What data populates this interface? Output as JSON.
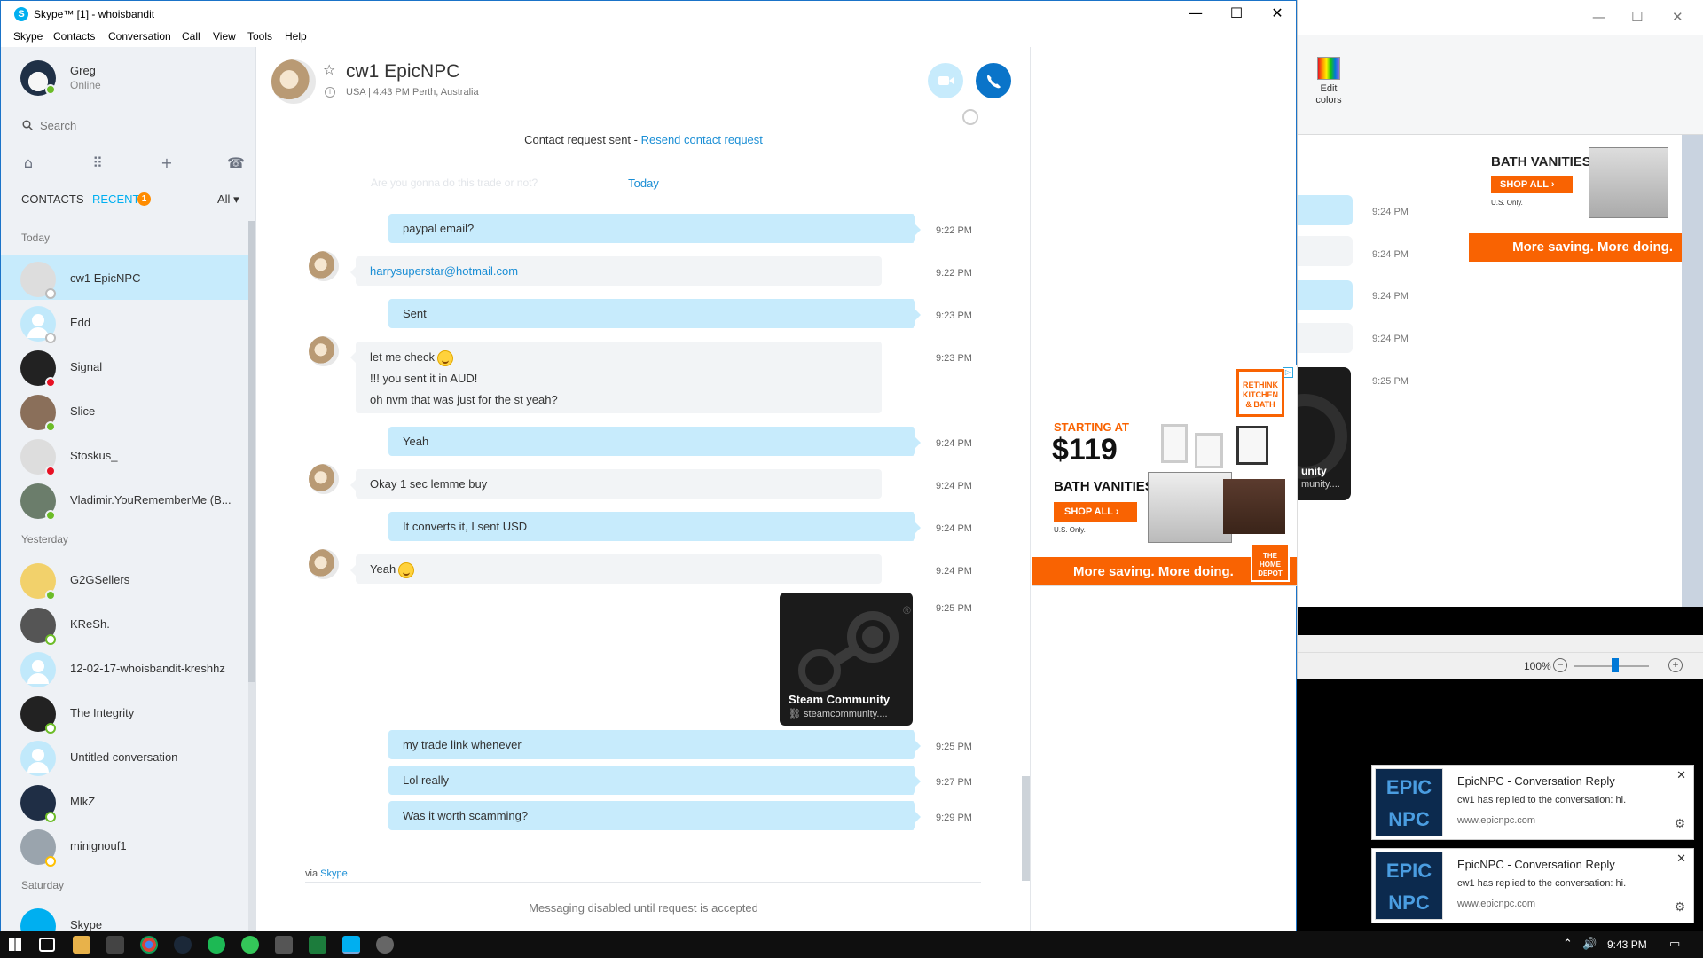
{
  "window": {
    "title": "Skype™ [1] - whoisbandit",
    "minimize": "—",
    "maximize": "☐",
    "close": "✕"
  },
  "menu": [
    "Skype",
    "Contacts",
    "Conversation",
    "Call",
    "View",
    "Tools",
    "Help"
  ],
  "profile": {
    "name": "Greg",
    "status": "Online"
  },
  "search": {
    "placeholder": "Search"
  },
  "tabs": {
    "contacts": "CONTACTS",
    "recent": "RECENT",
    "recent_badge": "1",
    "filter": "All"
  },
  "sections": {
    "today": "Today",
    "yesterday": "Yesterday",
    "saturday": "Saturday"
  },
  "contacts": [
    {
      "name": "cw1 EpicNPC",
      "presence": "unknown",
      "selected": true
    },
    {
      "name": "Edd",
      "presence": "unknown"
    },
    {
      "name": "Signal",
      "presence": "dnd"
    },
    {
      "name": "Slice",
      "presence": "online"
    },
    {
      "name": "Stoskus_",
      "presence": "dnd"
    },
    {
      "name": "Vladimir.YouRememberMe (B...",
      "presence": "online"
    },
    {
      "name": "G2GSellers",
      "presence": "online"
    },
    {
      "name": "KReSh.",
      "presence": "offline"
    },
    {
      "name": "12-02-17-whoisbandit-kreshhz",
      "presence": "none"
    },
    {
      "name": "The Integrity",
      "presence": "offline"
    },
    {
      "name": "Untitled conversation",
      "presence": "none"
    },
    {
      "name": "MlkZ",
      "presence": "offline"
    },
    {
      "name": "minignouf1",
      "presence": "away"
    },
    {
      "name": "Skype",
      "presence": "none"
    }
  ],
  "conversation": {
    "name": "cw1 EpicNPC",
    "meta": "USA  |  4:43 PM Perth, Australia",
    "contact_request": "Contact request sent - ",
    "resend_link": "Resend contact request",
    "ghost_text": "Are you gonna do this trade or not?",
    "day_label": "Today",
    "messages": [
      {
        "dir": "out",
        "lines": [
          "paypal email?"
        ],
        "time": "9:22 PM"
      },
      {
        "dir": "in",
        "lines": [
          "harrysuperstar@hotmail.com"
        ],
        "time": "9:22 PM",
        "link": true
      },
      {
        "dir": "out",
        "lines": [
          "Sent"
        ],
        "time": "9:23 PM"
      },
      {
        "dir": "in",
        "lines": [
          "let me check",
          "!!! you sent it in AUD!",
          "oh nvm that was just for the st yeah?"
        ],
        "time": "9:23 PM",
        "emoji_after_first": true
      },
      {
        "dir": "out",
        "lines": [
          "Yeah"
        ],
        "time": "9:24 PM"
      },
      {
        "dir": "in",
        "lines": [
          "Okay 1 sec lemme buy"
        ],
        "time": "9:24 PM"
      },
      {
        "dir": "out",
        "lines": [
          "It converts it, I sent USD"
        ],
        "time": "9:24 PM"
      },
      {
        "dir": "in",
        "lines": [
          "Yeah"
        ],
        "time": "9:24 PM",
        "emoji_after_first": true
      },
      {
        "dir": "card",
        "time": "9:25 PM"
      },
      {
        "dir": "out",
        "lines": [
          "my trade link whenever"
        ],
        "time": "9:25 PM"
      },
      {
        "dir": "out",
        "lines": [
          "Lol really"
        ],
        "time": "9:27 PM"
      },
      {
        "dir": "out",
        "lines": [
          "Was it worth scamming?"
        ],
        "time": "9:29 PM"
      }
    ],
    "card": {
      "title": "Steam Community",
      "url": "steamcommunity....",
      "mark": "®"
    },
    "via": "via ",
    "via_link": "Skype",
    "disabled": "Messaging disabled until request is accepted"
  },
  "ad": {
    "corner": "RETHINK KITCHEN & BATH",
    "starting": "STARTING AT",
    "price": "$119",
    "headline": "BATH VANITIES",
    "cta": "SHOP ALL ›",
    "fine": "U.S. Only.",
    "footer": "More saving. More doing.",
    "logo": "THE HOME DEPOT"
  },
  "bg_window": {
    "edit_colors": "Edit colors",
    "zoom": "100%",
    "times": [
      "9:24 PM",
      "9:24 PM",
      "9:24 PM",
      "9:24 PM",
      "9:25 PM"
    ],
    "steam_fragment": "unity",
    "steam_fragment2": "munity...."
  },
  "notifications": [
    {
      "logo": "EPIC NPC",
      "title": "EpicNPC - Conversation Reply",
      "body": "cw1 has replied to the conversation: hi.",
      "site": "www.epicnpc.com"
    },
    {
      "logo": "EPIC NPC",
      "title": "EpicNPC - Conversation Reply",
      "body": "cw1 has replied to the conversation: hi.",
      "site": "www.epicnpc.com"
    }
  ],
  "taskbar": {
    "time": "9:43 PM"
  }
}
